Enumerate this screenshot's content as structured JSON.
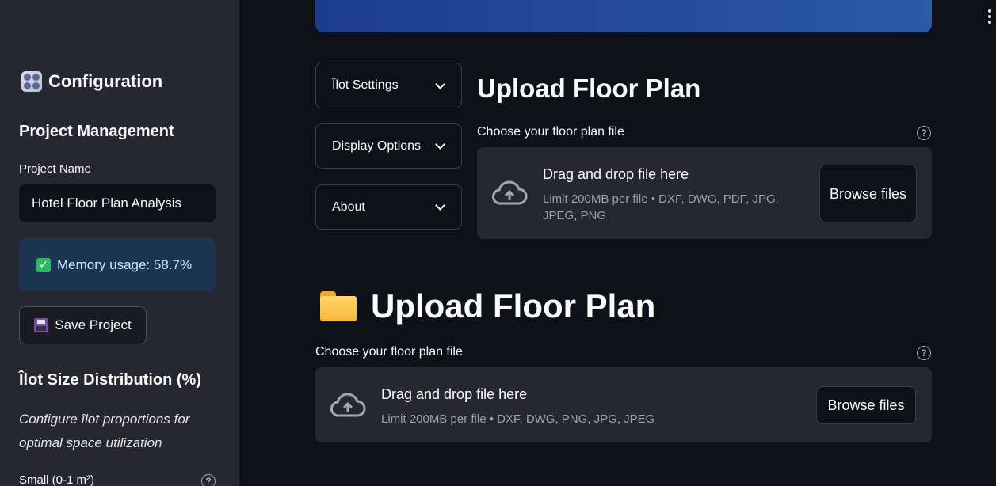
{
  "sidebar": {
    "title": "Configuration",
    "project_section": "Project Management",
    "project_name_label": "Project Name",
    "project_name_value": "Hotel Floor Plan Analysis",
    "memory_text": "Memory usage: 58.7%",
    "save_button": "Save Project",
    "distribution_header": "Îlot Size Distribution (%)",
    "distribution_caption": "Configure îlot proportions for optimal space utilization",
    "small_label": "Small (0-1 m²)"
  },
  "expanders": [
    {
      "label": "Îlot Settings"
    },
    {
      "label": "Display Options"
    },
    {
      "label": "About"
    }
  ],
  "upload1": {
    "title": "Upload Floor Plan",
    "label": "Choose your floor plan file",
    "drop_title": "Drag and drop file here",
    "drop_sub": "Limit 200MB per file • DXF, DWG, PDF, JPG, JPEG, PNG",
    "browse": "Browse files"
  },
  "upload2": {
    "title": "Upload Floor Plan",
    "label": "Choose your floor plan file",
    "drop_title": "Drag and drop file here",
    "drop_sub": "Limit 200MB per file • DXF, DWG, PNG, JPG, JPEG",
    "browse": "Browse files"
  },
  "icons": {
    "help": "?"
  },
  "colors": {
    "background": "#0e1117",
    "sidebar": "#262730",
    "banner": "#1e3c8c",
    "alert": "#1c3554"
  }
}
